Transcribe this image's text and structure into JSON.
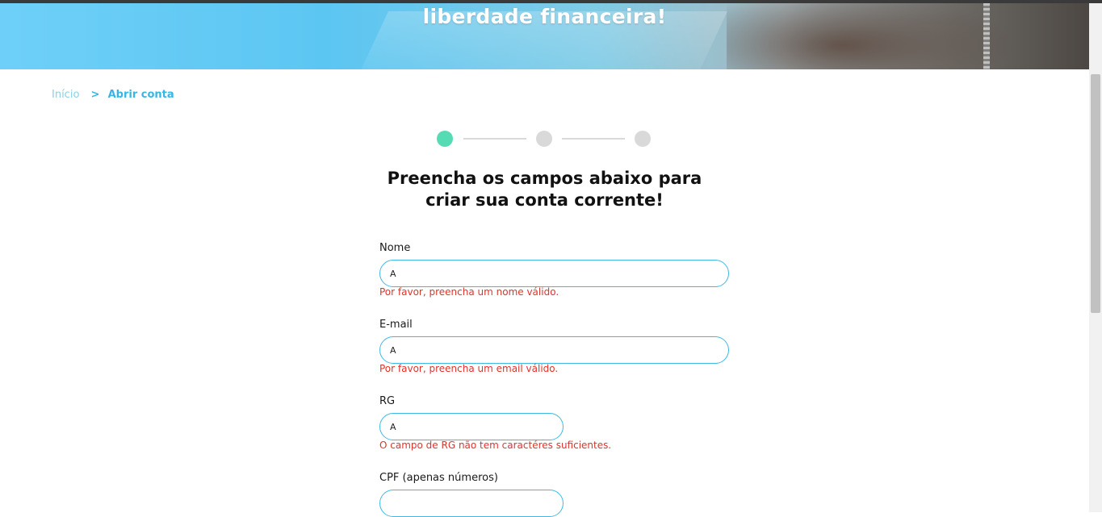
{
  "hero": {
    "title": "liberdade financeira!"
  },
  "breadcrumb": {
    "home": "Início",
    "separator": ">",
    "current": "Abrir conta"
  },
  "stepper": {
    "steps": 3,
    "active": 1,
    "active_color": "#55dcb4",
    "inactive_color": "#d9d9d9"
  },
  "form": {
    "title_line1": "Preencha os campos abaixo para",
    "title_line2": "criar sua conta corrente!",
    "fields": [
      {
        "label": "Nome",
        "value": "A",
        "error": "Por favor, preencha um nome válido."
      },
      {
        "label": "E-mail",
        "value": "A",
        "error": "Por favor, preencha um email válido."
      },
      {
        "label": "RG",
        "value": "A",
        "error": "O campo de RG não tem caractéres suficientes."
      },
      {
        "label": "CPF (apenas números)",
        "value": "",
        "error": ""
      }
    ]
  },
  "colors": {
    "accent": "#36b6e6",
    "input_border": "#3fb9e3",
    "error": "#e0332b"
  }
}
